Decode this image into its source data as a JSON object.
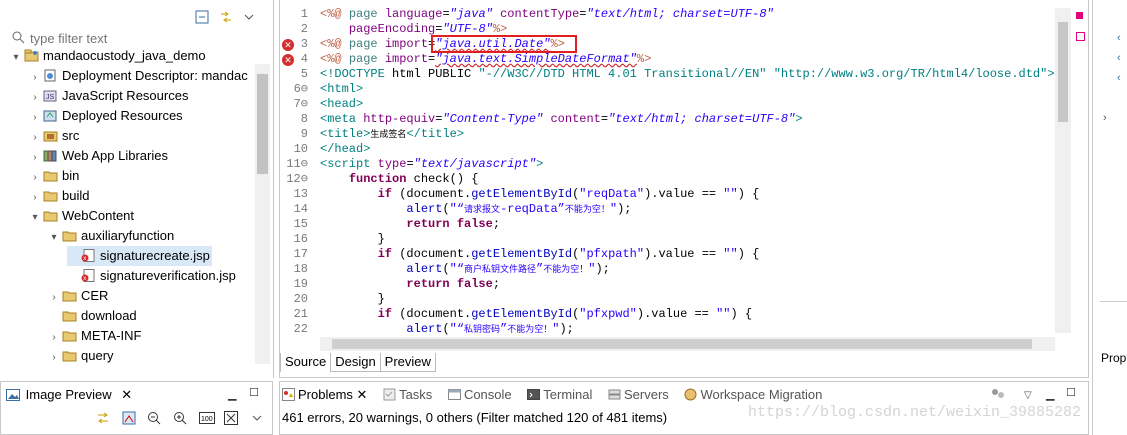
{
  "explorer": {
    "filter_placeholder": "type filter text",
    "tree": [
      {
        "label": "mandaocustody_java_demo",
        "icon": "project-icon",
        "twisty": "▾",
        "level": 0
      },
      {
        "label": "Deployment Descriptor: mandac",
        "icon": "deployment-descriptor-icon",
        "twisty": "›",
        "level": 1
      },
      {
        "label": "JavaScript Resources",
        "icon": "js-resources-icon",
        "twisty": "›",
        "level": 1
      },
      {
        "label": "Deployed Resources",
        "icon": "deployed-resources-icon",
        "twisty": "›",
        "level": 1
      },
      {
        "label": "src",
        "icon": "source-folder-icon",
        "twisty": "›",
        "level": 1
      },
      {
        "label": "Web App Libraries",
        "icon": "library-icon",
        "twisty": "›",
        "level": 1
      },
      {
        "label": "bin",
        "icon": "folder-icon",
        "twisty": "›",
        "level": 1
      },
      {
        "label": "build",
        "icon": "folder-icon",
        "twisty": "›",
        "level": 1
      },
      {
        "label": "WebContent",
        "icon": "folder-icon",
        "twisty": "▾",
        "level": 1
      },
      {
        "label": "auxiliaryfunction",
        "icon": "folder-icon",
        "twisty": "▾",
        "level": 2
      },
      {
        "label": "signaturecreate.jsp",
        "icon": "jsp-error-icon",
        "twisty": "",
        "level": 3,
        "selected": true
      },
      {
        "label": "signatureverification.jsp",
        "icon": "jsp-error-icon",
        "twisty": "",
        "level": 3
      },
      {
        "label": "CER",
        "icon": "folder-icon",
        "twisty": "›",
        "level": 2
      },
      {
        "label": "download",
        "icon": "folder-icon",
        "twisty": "",
        "level": 2
      },
      {
        "label": "META-INF",
        "icon": "folder-icon",
        "twisty": "›",
        "level": 2
      },
      {
        "label": "query",
        "icon": "folder-icon",
        "twisty": "›",
        "level": 2
      }
    ]
  },
  "editor": {
    "line_numbers": [
      "1",
      "2",
      "3",
      "4",
      "5",
      "6⊖",
      "7⊖",
      "8",
      "9",
      "10",
      "11⊖",
      "12⊖",
      "13",
      "14",
      "15",
      "16",
      "17",
      "18",
      "19",
      "20",
      "21",
      "22"
    ],
    "tabs": [
      "Source",
      "Design",
      "Preview"
    ],
    "active_tab": "Source"
  },
  "image_preview": {
    "title": "Image Preview"
  },
  "problems": {
    "tabs": [
      "Problems",
      "Tasks",
      "Console",
      "Terminal",
      "Servers",
      "Workspace Migration"
    ],
    "status": "461 errors, 20 warnings, 0 others (Filter matched 120 of 481 items)"
  },
  "watermark": "https://blog.csdn.net/weixin_39885282",
  "right_strip": {
    "label": "Prop"
  },
  "colors": {
    "error": "#d32f2f",
    "highlight_box": "#e02020",
    "keyword": "#7f0055",
    "string": "#2a00ff",
    "tag": "#3f7f7f"
  }
}
